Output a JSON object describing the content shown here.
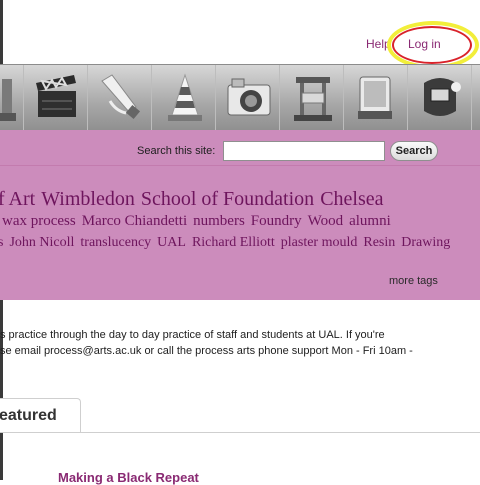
{
  "header": {
    "help_label": "Help",
    "login_label": "Log in"
  },
  "banner": {
    "icons": [
      "figurine-icon",
      "clapperboard-icon",
      "paint-tube-icon",
      "traffic-cone-icon",
      "camera-icon",
      "press-machine-icon",
      "tablet-device-icon",
      "welding-mask-icon",
      "spotlight-icon"
    ]
  },
  "search": {
    "label": "Search this site:",
    "value": "",
    "button_label": "Search"
  },
  "tags": {
    "line1": [
      "f Art",
      "Wimbledon",
      "School of Foundation",
      "Chelsea"
    ],
    "line2": [
      "wax process",
      "Marco Chiandetti",
      "numbers",
      "Foundry",
      "Wood",
      "alumni"
    ],
    "line3": [
      "s",
      "John Nicoll",
      "translucency",
      "UAL",
      "Richard Elliott",
      "plaster mould",
      "Resin",
      "Drawing"
    ],
    "more_label": "more tags"
  },
  "about": {
    "line1": "s practice through the day to day practice of staff and students at UAL. If you're",
    "line2": "se email process@arts.ac.uk or call the process arts phone support Mon - Fri 10am -"
  },
  "tabs": {
    "featured_label": "eatured"
  },
  "post": {
    "title": "Making a Black Repeat"
  },
  "colors": {
    "accent": "#8a2a73",
    "tag_panel": "#cc8cbc",
    "highlight_yellow": "#f2ee3a",
    "highlight_red": "#d9222a"
  }
}
